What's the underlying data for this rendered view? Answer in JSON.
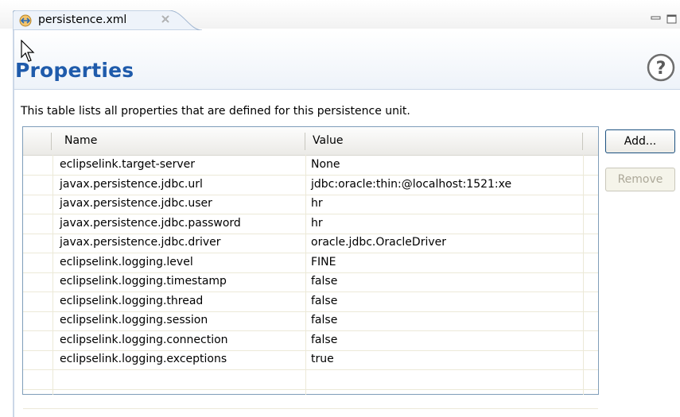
{
  "editor_tab": {
    "title": "persistence.xml",
    "icon": "xml-file-icon",
    "close_icon": "close-icon"
  },
  "view_controls": [
    "minimize-icon",
    "maximize-icon"
  ],
  "form": {
    "title": "Properties",
    "help_icon": "help-icon",
    "description": "This table lists all properties that are defined for this persistence unit."
  },
  "table": {
    "columns": [
      "Name",
      "Value"
    ],
    "rows": [
      {
        "name": "eclipselink.target-server",
        "value": "None"
      },
      {
        "name": "javax.persistence.jdbc.url",
        "value": "jdbc:oracle:thin:@localhost:1521:xe"
      },
      {
        "name": "javax.persistence.jdbc.user",
        "value": "hr"
      },
      {
        "name": "javax.persistence.jdbc.password",
        "value": "hr"
      },
      {
        "name": "javax.persistence.jdbc.driver",
        "value": "oracle.jdbc.OracleDriver"
      },
      {
        "name": "eclipselink.logging.level",
        "value": "FINE"
      },
      {
        "name": "eclipselink.logging.timestamp",
        "value": "false"
      },
      {
        "name": "eclipselink.logging.thread",
        "value": "false"
      },
      {
        "name": "eclipselink.logging.session",
        "value": "false"
      },
      {
        "name": "eclipselink.logging.connection",
        "value": "false"
      },
      {
        "name": "eclipselink.logging.exceptions",
        "value": "true"
      }
    ]
  },
  "buttons": {
    "add": "Add...",
    "remove": "Remove"
  },
  "colors": {
    "title": "#1f5bab",
    "header_gradient_end": "#eef3f9",
    "table_border": "#7f9db9",
    "button_border": "#1c5180",
    "disabled_text": "#aca899"
  }
}
